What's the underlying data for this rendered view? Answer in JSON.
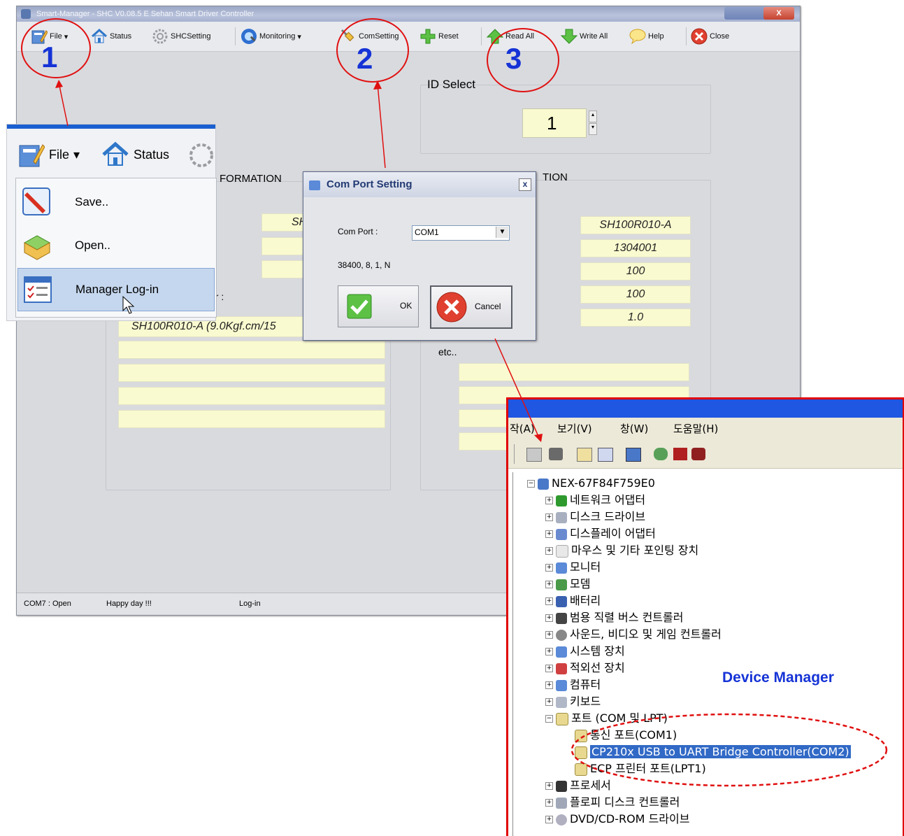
{
  "window": {
    "title": "Smart-Manager - SHC  V0.08.5 E  Sehan Smart Driver Controller",
    "close_glyph": "X"
  },
  "toolbar": {
    "file": "File",
    "status": "Status",
    "shcsetting": "SHCSetting",
    "monitoring": "Monitoring",
    "comsetting": "ComSetting",
    "reset": "Reset",
    "read_all": "Read All",
    "write_all": "Write All",
    "help": "Help",
    "close": "Close"
  },
  "annotations": {
    "num1": "1",
    "num2": "2",
    "num3": "3",
    "device_manager_label": "Device  Manager"
  },
  "id_select": {
    "label": "ID Select",
    "value": "1"
  },
  "left_panel": {
    "title_partial": "FORMATION",
    "fields": [
      "SH",
      "",
      ""
    ],
    "label_partial": "er :",
    "model_value": "SH100R010-A (9.0Kgf.cm/15"
  },
  "right_panel": {
    "title_partial": "TION",
    "values": [
      "SH100R010-A",
      "1304001",
      "100",
      "100",
      "1.0"
    ],
    "etc_label": "etc.."
  },
  "statusbar": {
    "com": "COM7 : Open",
    "message": "Happy day !!!",
    "login": "Log-in"
  },
  "file_popup": {
    "file": "File",
    "status": "Status",
    "menu": [
      "Save..",
      "Open..",
      "Manager Log-in"
    ]
  },
  "com_dialog": {
    "title": "Com Port Setting",
    "close_glyph": "x",
    "port_label": "Com Port :",
    "port_value": "COM1",
    "params": "38400, 8, 1, N",
    "ok": "OK",
    "cancel": "Cancel"
  },
  "device_manager": {
    "menu": [
      "작(A)",
      "보기(V)",
      "창(W)",
      "도움말(H)"
    ],
    "root": "NEX-67F84F759E0",
    "items": [
      "네트워크 어댑터",
      "디스크 드라이브",
      "디스플레이 어댑터",
      "마우스 및 기타 포인팅 장치",
      "모니터",
      "모뎀",
      "배터리",
      "범용 직렬 버스 컨트롤러",
      "사운드, 비디오 및 게임 컨트롤러",
      "시스템 장치",
      "적외선 장치",
      "컴퓨터",
      "키보드",
      "포트 (COM 및 LPT)"
    ],
    "ports": [
      "통신 포트(COM1)",
      "CP210x USB to UART Bridge Controller(COM2)",
      "ECP 프린터 포트(LPT1)"
    ],
    "after": [
      "프로세서",
      "플로피 디스크 컨트롤러",
      "DVD/CD-ROM 드라이브"
    ]
  }
}
